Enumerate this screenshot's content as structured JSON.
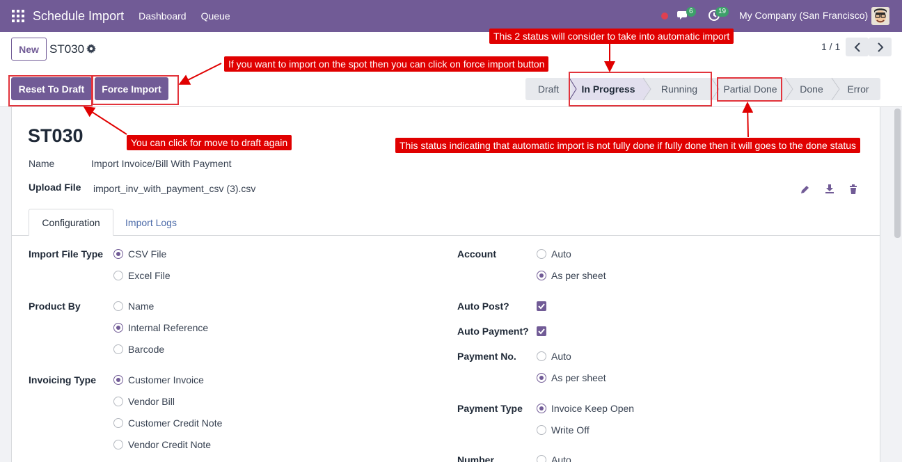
{
  "navbar": {
    "app_title": "Schedule Import",
    "links": [
      "Dashboard",
      "Queue"
    ],
    "messages_count": "6",
    "activities_count": "19",
    "company": "My Company (San Francisco)"
  },
  "control_panel": {
    "new_label": "New",
    "breadcrumb": "ST030",
    "pager": "1 / 1"
  },
  "header_buttons": {
    "reset_label": "Reset To Draft",
    "force_label": "Force Import"
  },
  "statusbar": {
    "stages": [
      "Draft",
      "In Progress",
      "Running",
      "Partial Done",
      "Done",
      "Error"
    ],
    "active": "In Progress"
  },
  "record": {
    "title": "ST030",
    "name_label": "Name",
    "name_value": "Import Invoice/Bill With Payment",
    "upload_label": "Upload File",
    "upload_value": "import_inv_with_payment_csv (3).csv"
  },
  "tabs": [
    "Configuration",
    "Import Logs"
  ],
  "left_fields": {
    "import_file_type": {
      "label": "Import File Type",
      "options": [
        "CSV File",
        "Excel File"
      ],
      "selected": "CSV File"
    },
    "product_by": {
      "label": "Product By",
      "options": [
        "Name",
        "Internal Reference",
        "Barcode"
      ],
      "selected": "Internal Reference"
    },
    "invoicing_type": {
      "label": "Invoicing Type",
      "options": [
        "Customer Invoice",
        "Vendor Bill",
        "Customer Credit Note",
        "Vendor Credit Note"
      ],
      "selected": "Customer Invoice"
    }
  },
  "right_fields": {
    "account": {
      "label": "Account",
      "options": [
        "Auto",
        "As per sheet"
      ],
      "selected": "As per sheet"
    },
    "auto_post": {
      "label": "Auto Post?",
      "checked": true
    },
    "auto_payment": {
      "label": "Auto Payment?",
      "checked": true
    },
    "payment_no": {
      "label": "Payment No.",
      "options": [
        "Auto",
        "As per sheet"
      ],
      "selected": "As per sheet"
    },
    "payment_type": {
      "label": "Payment Type",
      "options": [
        "Invoice Keep Open",
        "Write Off"
      ],
      "selected": "Invoice Keep Open"
    },
    "number": {
      "label": "Number",
      "options": [
        "Auto"
      ]
    }
  },
  "annotations": {
    "status_consider": "This 2 status will consider to take into automatic import",
    "force_import": "If you want to import on the spot then you can click on force import button",
    "move_draft": "You can click for move to draft again",
    "partial_done": "This status indicating that automatic import is not fully done if fully done then it will goes to the done status"
  },
  "colors": {
    "brand": "#715b96",
    "annotation": "#e00000"
  }
}
